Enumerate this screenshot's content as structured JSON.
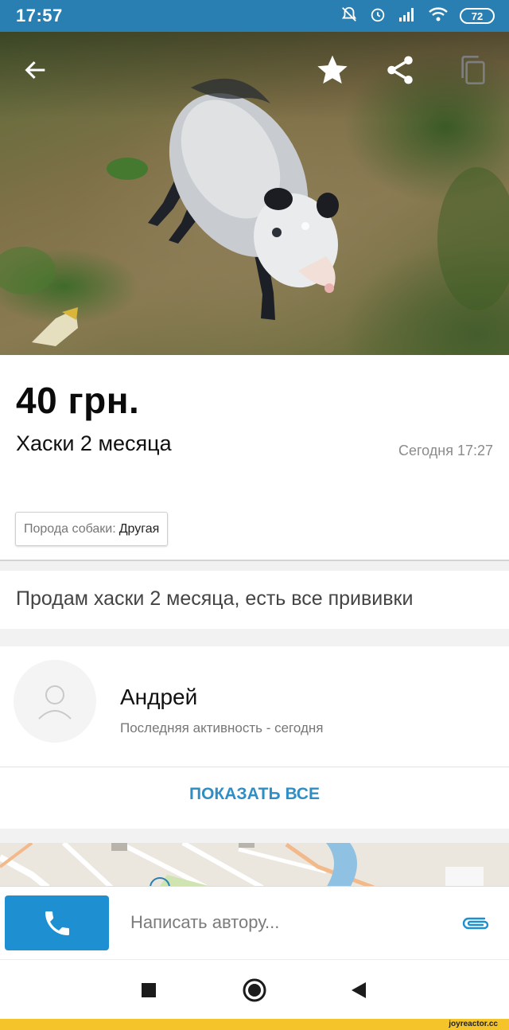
{
  "status_bar": {
    "time": "17:57",
    "battery": "72",
    "icons": [
      "notifications-off-icon",
      "alarm-icon",
      "signal-icon",
      "wifi-icon",
      "battery-icon"
    ]
  },
  "toolbar": {
    "back_icon": "arrow-left-icon",
    "favorite_icon": "star-icon",
    "share_icon": "share-icon",
    "copy_icon": "copy-icon"
  },
  "listing": {
    "price": "40 грн.",
    "title": "Хаски 2 месяца",
    "date": "Сегодня 17:27",
    "param_label": "Порода собаки:",
    "param_value": "Другая",
    "description": "Продам хаски 2 месяца, есть все прививки"
  },
  "author": {
    "name": "Андрей",
    "activity": "Последняя активность - сегодня",
    "show_all": "ПОКАЗАТЬ ВСЕ"
  },
  "actions": {
    "message_placeholder": "Написать автору..."
  },
  "watermark": "joyreactor.cc",
  "colors": {
    "status_bar": "#2a7fb2",
    "call_button": "#1e8fd0",
    "link": "#2f8ec4",
    "footer_strip": "#f5c42b"
  }
}
